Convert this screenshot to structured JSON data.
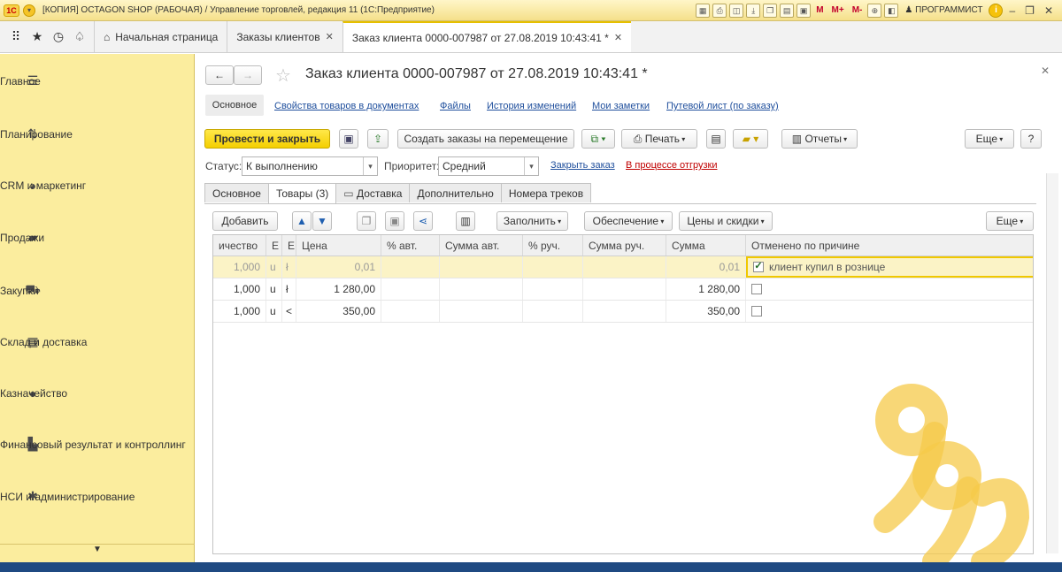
{
  "window": {
    "title": "[КОПИЯ] OCTAGON SHOP (РАБОЧАЯ) / Управление торговлей, редакция 11  (1С:Предприятие)",
    "user": "ПРОГРАММИСТ",
    "toolbar_m": [
      "M",
      "M+",
      "M-"
    ]
  },
  "nav": {
    "home": "Начальная страница",
    "tabs": [
      {
        "label": "Заказы клиентов"
      },
      {
        "label": "Заказ клиента 0000-007987 от 27.08.2019 10:43:41 *"
      }
    ]
  },
  "sidebar": {
    "items": [
      {
        "label": "Главное",
        "icon": "menu-icon"
      },
      {
        "label": "Планирование",
        "icon": "planning-icon"
      },
      {
        "label": "CRM и маркетинг",
        "icon": "pie-icon"
      },
      {
        "label": "Продажи",
        "icon": "bag-icon"
      },
      {
        "label": "Закупки",
        "icon": "cart-icon"
      },
      {
        "label": "Склад и доставка",
        "icon": "warehouse-icon"
      },
      {
        "label": "Казначейство",
        "icon": "coin-icon"
      },
      {
        "label": "Финансовый результат и контроллинг",
        "icon": "bar-chart-icon"
      },
      {
        "label": "НСИ и администрирование",
        "icon": "gear-icon"
      }
    ]
  },
  "doc": {
    "title": "Заказ клиента 0000-007987 от 27.08.2019 10:43:41 *",
    "links": [
      "Основное",
      "Свойства товаров в документах",
      "Файлы",
      "История изменений",
      "Мои заметки",
      "Путевой лист (по заказу)"
    ],
    "buttons": {
      "post_close": "Провести и закрыть",
      "create_moves": "Создать заказы на перемещение",
      "print": "Печать",
      "reports": "Отчеты",
      "more": "Еще",
      "help": "?"
    },
    "status_label": "Статус:",
    "status_value": "К выполнению",
    "priority_label": "Приоритет:",
    "priority_value": "Средний",
    "close_order": "Закрыть заказ",
    "in_shipping": "В процессе отгрузки",
    "tabs": [
      "Основное",
      "Товары (3)",
      "Доставка",
      "Дополнительно",
      "Номера треков"
    ],
    "table_toolbar": {
      "add": "Добавить",
      "fill": "Заполнить",
      "provision": "Обеспечение",
      "prices": "Цены и скидки",
      "more": "Еще"
    },
    "columns": [
      "ичество",
      "Е",
      "Е",
      "Цена",
      "% авт.",
      "Сумма авт.",
      "% руч.",
      "Сумма руч.",
      "Сумма",
      "Отменено по причине"
    ],
    "rows": [
      {
        "qty": "1,000",
        "u1": "u",
        "u2": "ł",
        "price": "0,01",
        "sum": "0,01",
        "cancelled": true,
        "reason": "клиент купил в рознице"
      },
      {
        "qty": "1,000",
        "u1": "u",
        "u2": "ł",
        "price": "1 280,00",
        "sum": "1 280,00",
        "cancelled": false,
        "reason": ""
      },
      {
        "qty": "1,000",
        "u1": "u",
        "u2": "<",
        "price": "350,00",
        "sum": "350,00",
        "cancelled": false,
        "reason": ""
      }
    ]
  },
  "colors": {
    "accent": "#f4cf00",
    "sidebar": "#fbed9e",
    "link": "#1e4e9c",
    "alert": "#c00000"
  }
}
